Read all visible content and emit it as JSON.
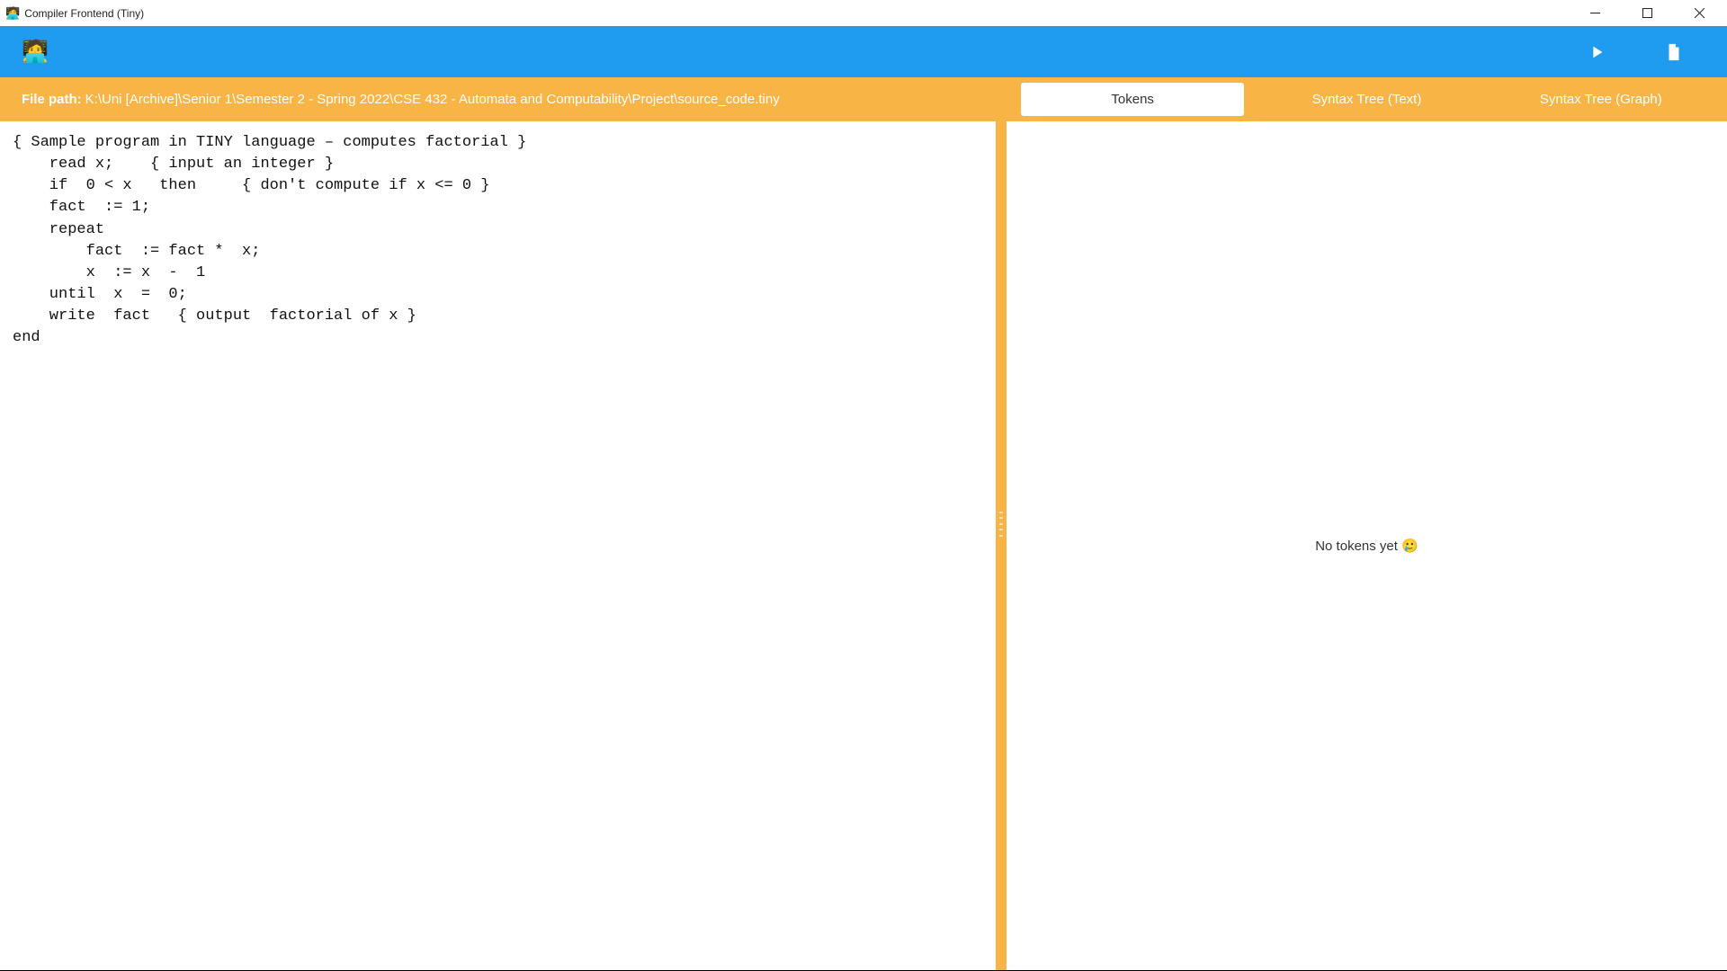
{
  "window": {
    "title": "Compiler Frontend (Tiny)",
    "icon": "🧑‍💻"
  },
  "toolbar": {
    "logo": "🧑‍💻"
  },
  "filepath": {
    "label": "File path:",
    "value": "K:\\Uni [Archive]\\Senior 1\\Semester 2 - Spring 2022\\CSE 432 - Automata and Computability\\Project\\source_code.tiny"
  },
  "code": "{ Sample program in TINY language – computes factorial }\n    read x;    { input an integer }\n    if  0 < x   then     { don't compute if x <= 0 }\n    fact  := 1;\n    repeat\n        fact  := fact *  x;\n        x  := x  -  1\n    until  x  =  0;\n    write  fact   { output  factorial of x }\nend",
  "tabs": [
    {
      "label": "Tokens",
      "active": true
    },
    {
      "label": "Syntax Tree (Text)",
      "active": false
    },
    {
      "label": "Syntax Tree (Graph)",
      "active": false
    }
  ],
  "tokens_empty": "No tokens yet  🥲"
}
